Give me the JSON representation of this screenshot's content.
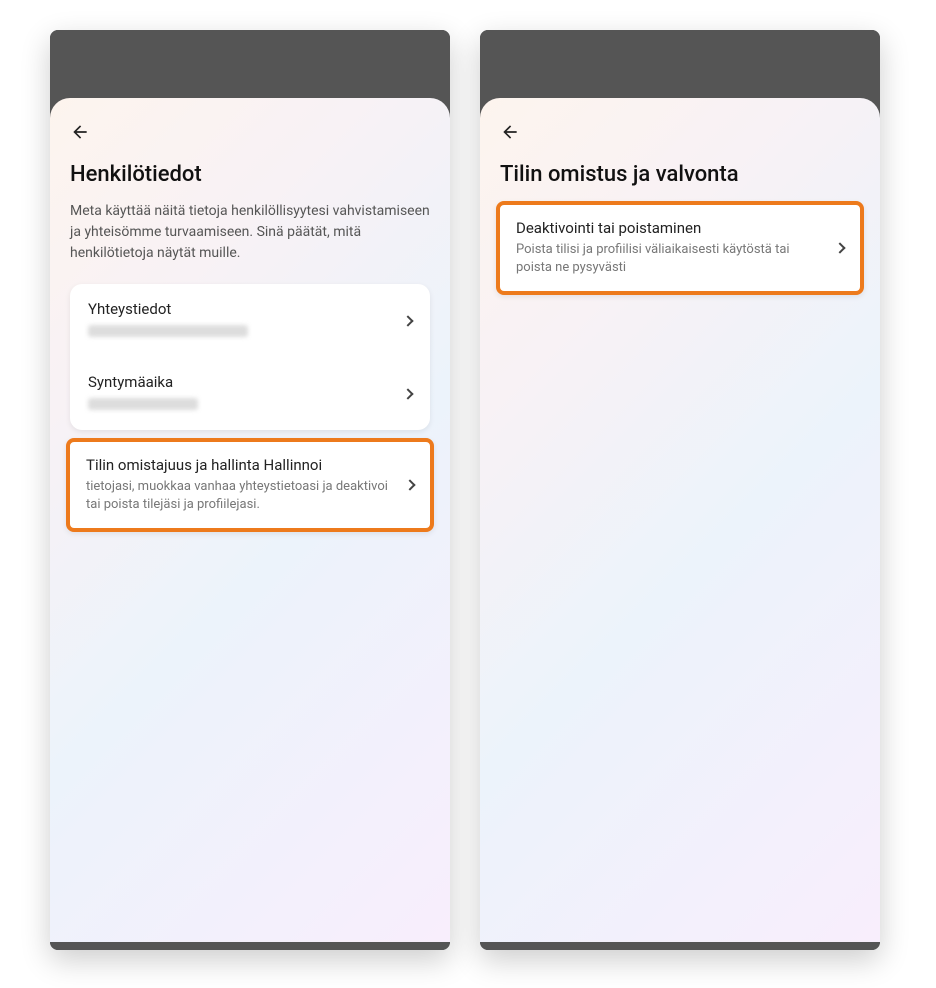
{
  "screen1": {
    "title": "Henkilötiedot",
    "description": "Meta käyttää näitä tietoja henkilöllisyytesi vahvistamiseen ja yhteisömme turvaamiseen. Sinä päätät, mitä henkilötietoja näytät muille.",
    "items": [
      {
        "title": "Yhteystiedot"
      },
      {
        "title": "Syntymäaika"
      },
      {
        "title": "Tilin omistajuus ja hallinta Hallinnoi",
        "subtitle": "tietojasi, muokkaa vanhaa yhteystietoasi ja deaktivoi tai poista tilejäsi ja profiilejasi."
      }
    ]
  },
  "screen2": {
    "title": "Tilin omistus ja valvonta",
    "items": [
      {
        "title": "Deaktivointi tai poistaminen",
        "subtitle": "Poista tilisi ja profiilisi väliaikaisesti käytöstä tai poista ne pysyvästi"
      }
    ]
  }
}
